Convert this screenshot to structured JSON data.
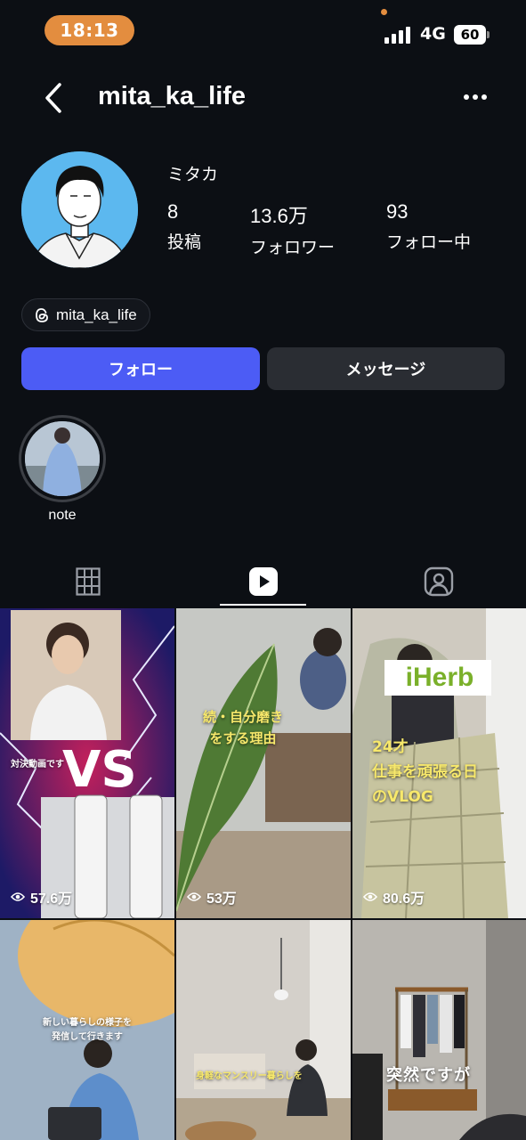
{
  "status_bar": {
    "time": "18:13",
    "network": "4G",
    "battery": "60"
  },
  "header": {
    "username": "mita_ka_life"
  },
  "profile": {
    "display_name": "ミタカ",
    "stats": [
      {
        "value": "8",
        "label": "投稿"
      },
      {
        "value": "13.6万",
        "label": "フォロワー"
      },
      {
        "value": "93",
        "label": "フォロー中"
      }
    ],
    "threads_handle": "mita_ka_life"
  },
  "actions": {
    "follow_label": "フォロー",
    "message_label": "メッセージ"
  },
  "highlights": [
    {
      "label": "note"
    }
  ],
  "tabs": [
    {
      "icon": "grid-icon"
    },
    {
      "icon": "reels-icon",
      "active": true
    },
    {
      "icon": "tagged-icon"
    }
  ],
  "reels": [
    {
      "views": "57.6万",
      "caption": "対決動画です",
      "overlay": "VS"
    },
    {
      "views": "53万",
      "caption": "続・自分磨き\nをする理由"
    },
    {
      "views": "80.6万",
      "caption": "24才\n仕事を頑張る日\nのVLOG",
      "logo": "iHerb"
    },
    {
      "caption": "新しい暮らしの様子を\n発信して行きます"
    },
    {
      "caption": "身軽なマンスリー暮らしを"
    },
    {
      "caption": "突然ですが"
    }
  ],
  "colors": {
    "accent": "#4c5cf5",
    "time_pill": "#e38d3f",
    "background": "#0c0f14"
  }
}
